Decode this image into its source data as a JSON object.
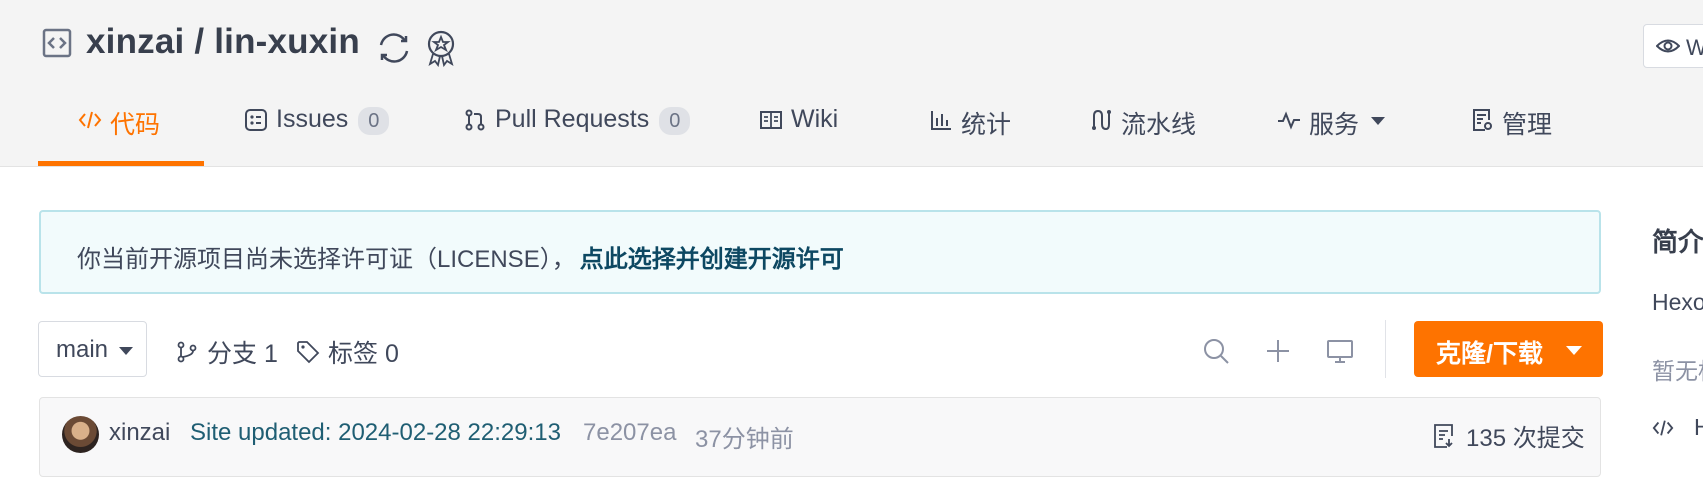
{
  "repo": {
    "title": "xinzai / lin-xuxin",
    "watch_label": "W"
  },
  "tabs": [
    {
      "label": "代码",
      "icon": "code-icon",
      "active": true
    },
    {
      "label": "Issues",
      "count": "0",
      "icon": "issues-icon"
    },
    {
      "label": "Pull Requests",
      "count": "0",
      "icon": "pull-request-icon"
    },
    {
      "label": "Wiki",
      "icon": "book-icon"
    },
    {
      "label": "统计",
      "icon": "bar-chart-icon"
    },
    {
      "label": "流水线",
      "icon": "pipeline-icon"
    },
    {
      "label": "服务",
      "icon": "pulse-icon",
      "dropdown": true
    },
    {
      "label": "管理",
      "icon": "settings-doc-icon"
    }
  ],
  "license_notice": {
    "text": "你当前开源项目尚未选择许可证（LICENSE），",
    "link": "点此选择并创建开源许可"
  },
  "toolbar": {
    "branch": "main",
    "branches_label": "分支 1",
    "tags_label": "标签 0",
    "clone_label": "克隆/下载"
  },
  "commit": {
    "user": "xinzai",
    "message": "Site updated: 2024-02-28 22:29:13",
    "hash": "7e207ea",
    "time": "37分钟前",
    "count_label": "135 次提交"
  },
  "sidebar": {
    "title": "简介",
    "desc": "Hexo",
    "none": "暂无标",
    "lang": "H"
  },
  "colors": {
    "accent": "#fe7300",
    "notice_bg": "#f2fbfc",
    "link": "#0d4862"
  }
}
